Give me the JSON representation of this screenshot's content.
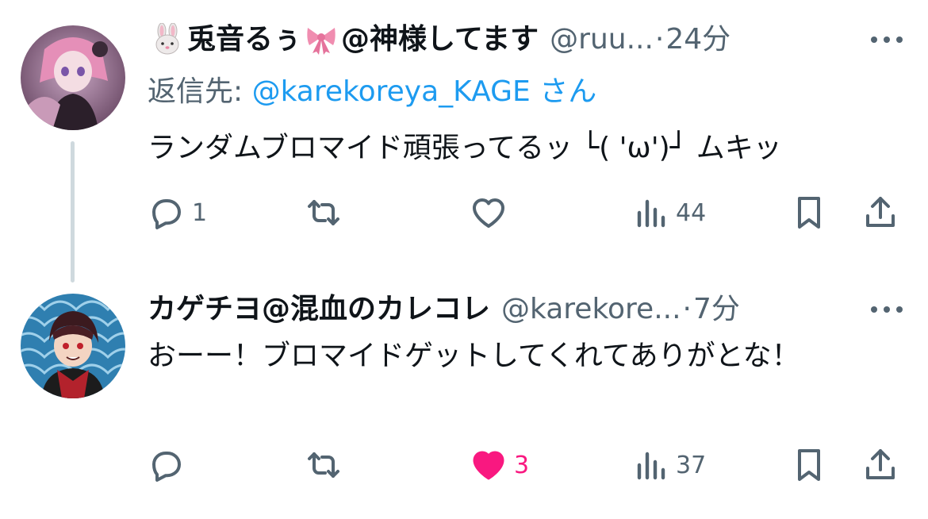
{
  "tweets": [
    {
      "display_name": "兎音るぅ",
      "display_name_suffix": "@神様してます",
      "handle": "@ruu...",
      "dot": "·",
      "time": "24分",
      "reply_label": "返信先: ",
      "reply_mention": "@karekoreya_KAGE",
      "reply_suffix": " さん",
      "text": "ランダムブロマイド頑張ってるッ └( 'ω')┘ ムキッ",
      "reply_count": "1",
      "retweet_count": "",
      "like_count": "",
      "liked": false,
      "view_count": "44",
      "name_emojis": [
        "rabbit-face",
        "ribbon"
      ]
    },
    {
      "display_name": "カゲチヨ@混血のカレコレ",
      "handle": "@karekore...",
      "dot": "·",
      "time": "7分",
      "text": "おーー！ブロマイドゲットしてくれてありがとな！",
      "reply_count": "",
      "retweet_count": "",
      "like_count": "3",
      "liked": true,
      "view_count": "37"
    }
  ],
  "colors": {
    "text": "#0f1419",
    "secondary": "#536471",
    "link": "#1d9bf0",
    "like": "#f91880",
    "thread_line": "#cfd9de"
  }
}
